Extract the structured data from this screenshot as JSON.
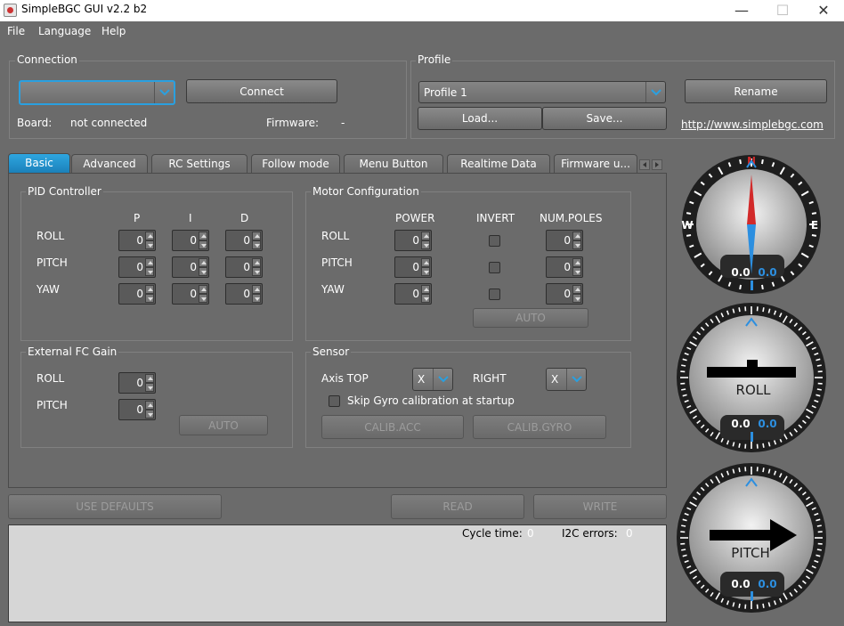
{
  "window": {
    "title": "SimpleBGC GUI v2.2 b2",
    "minimize": "—",
    "maximize": "☐",
    "close": "✕"
  },
  "menu": [
    "File",
    "Language",
    "Help"
  ],
  "connection": {
    "label": "Connection",
    "port_value": "",
    "connect_button": "Connect",
    "board_label": "Board:",
    "board_value": "not connected",
    "firmware_label": "Firmware:",
    "firmware_value": "-"
  },
  "profile": {
    "label": "Profile",
    "selected": "Profile 1",
    "rename_button": "Rename",
    "load_button": "Load...",
    "save_button": "Save...",
    "link": "http://www.simplebgc.com"
  },
  "tabs": [
    "Basic",
    "Advanced",
    "RC Settings",
    "Follow mode",
    "Menu Button",
    "Realtime Data",
    "Firmware u..."
  ],
  "pid": {
    "label": "PID Controller",
    "headers": [
      "P",
      "I",
      "D"
    ],
    "rows": [
      {
        "name": "ROLL",
        "values": [
          "0",
          "0",
          "0"
        ]
      },
      {
        "name": "PITCH",
        "values": [
          "0",
          "0",
          "0"
        ]
      },
      {
        "name": "YAW",
        "values": [
          "0",
          "0",
          "0"
        ]
      }
    ]
  },
  "motor": {
    "label": "Motor Configuration",
    "headers": [
      "POWER",
      "INVERT",
      "NUM.POLES"
    ],
    "rows": [
      {
        "name": "ROLL",
        "power": "0",
        "poles": "0"
      },
      {
        "name": "PITCH",
        "power": "0",
        "poles": "0"
      },
      {
        "name": "YAW",
        "power": "0",
        "poles": "0"
      }
    ],
    "auto_button": "AUTO"
  },
  "external_fc": {
    "label": "External FC Gain",
    "rows": [
      {
        "name": "ROLL",
        "value": "0"
      },
      {
        "name": "PITCH",
        "value": "0"
      }
    ],
    "auto_button": "AUTO"
  },
  "sensor": {
    "label": "Sensor",
    "axis_top_label": "Axis TOP",
    "axis_top_value": "X",
    "right_label": "RIGHT",
    "right_value": "X",
    "skip_gyro": "Skip Gyro calibration at startup",
    "calib_acc": "CALIB.ACC",
    "calib_gyro": "CALIB.GYRO"
  },
  "bottom": {
    "use_defaults": "USE DEFAULTS",
    "read": "READ",
    "write": "WRITE"
  },
  "status": {
    "cycle_label": "Cycle time:",
    "cycle_value": "0",
    "i2c_label": "I2C errors:",
    "i2c_value": "0"
  },
  "gauges": {
    "compass": {
      "n": "N",
      "e": "E",
      "w": "W",
      "v1": "0.0",
      "v2": "0.0"
    },
    "roll": {
      "label": "ROLL",
      "v1": "0.0",
      "v2": "0.0"
    },
    "pitch": {
      "label": "PITCH",
      "v1": "0.0",
      "v2": "0.0"
    }
  },
  "colors": {
    "tab_active": "#1a8fd0",
    "gauge_blue": "#2c8fe0",
    "needle_red": "#d22a2a"
  }
}
